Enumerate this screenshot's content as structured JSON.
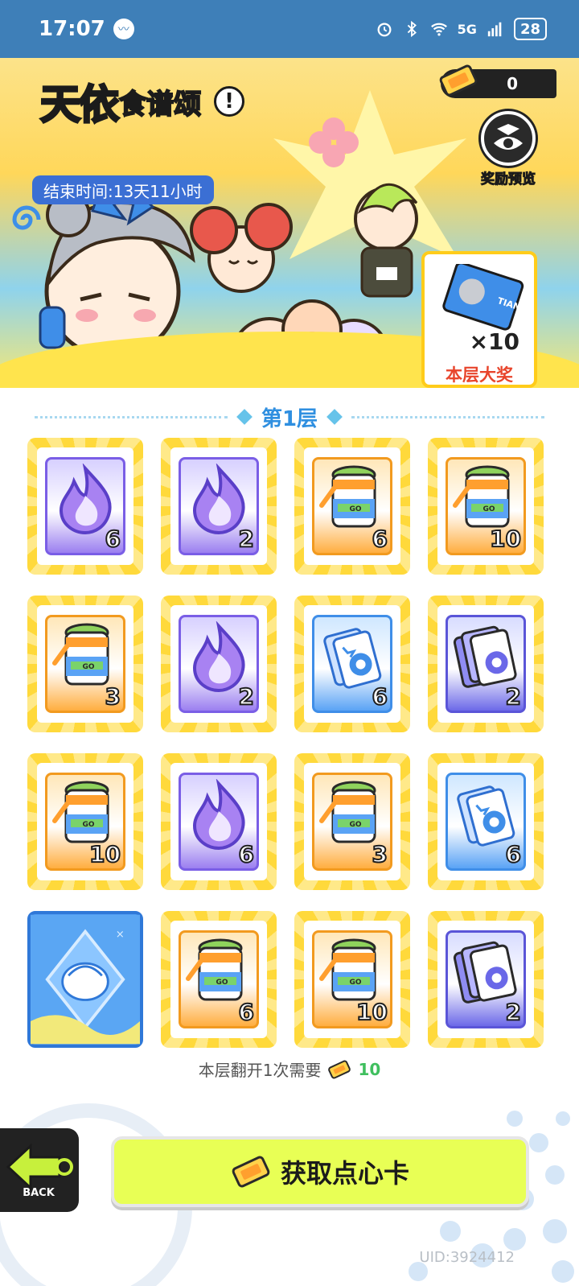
{
  "status_bar": {
    "time": "17:07",
    "network": "5G",
    "battery": "28"
  },
  "banner": {
    "title_main": "天依",
    "title_sub": "食谱颂",
    "end_time": "结束时间:13天11小时",
    "ticket_count": "0",
    "reward_preview_label": "奖励预览",
    "grand_prize_qty": "×10",
    "grand_prize_label": "本层大奖",
    "grand_prize_card_text": "TIANYI"
  },
  "floor": {
    "title": "第1层"
  },
  "cards": [
    {
      "type": "fire",
      "count": "6"
    },
    {
      "type": "fire",
      "count": "2"
    },
    {
      "type": "jar",
      "count": "6"
    },
    {
      "type": "jar",
      "count": "10"
    },
    {
      "type": "jar",
      "count": "3"
    },
    {
      "type": "fire",
      "count": "2"
    },
    {
      "type": "ticket-blue",
      "count": "6"
    },
    {
      "type": "ticket-violet",
      "count": "2"
    },
    {
      "type": "jar",
      "count": "10"
    },
    {
      "type": "fire",
      "count": "6"
    },
    {
      "type": "jar",
      "count": "3"
    },
    {
      "type": "ticket-blue",
      "count": "6"
    },
    {
      "type": "flipped",
      "count": ""
    },
    {
      "type": "jar",
      "count": "6"
    },
    {
      "type": "jar",
      "count": "10"
    },
    {
      "type": "ticket-violet",
      "count": "2"
    }
  ],
  "cost": {
    "text": "本层翻开1次需要",
    "value": "10"
  },
  "buttons": {
    "back_label": "BACK",
    "get_cards_label": "获取点心卡"
  },
  "uid": "UID:3924412",
  "colors": {
    "accent_yellow": "#ffd93b",
    "accent_blue": "#2f8fe0",
    "button_lime": "#e8ff55",
    "cost_green": "#3fbf5e"
  }
}
